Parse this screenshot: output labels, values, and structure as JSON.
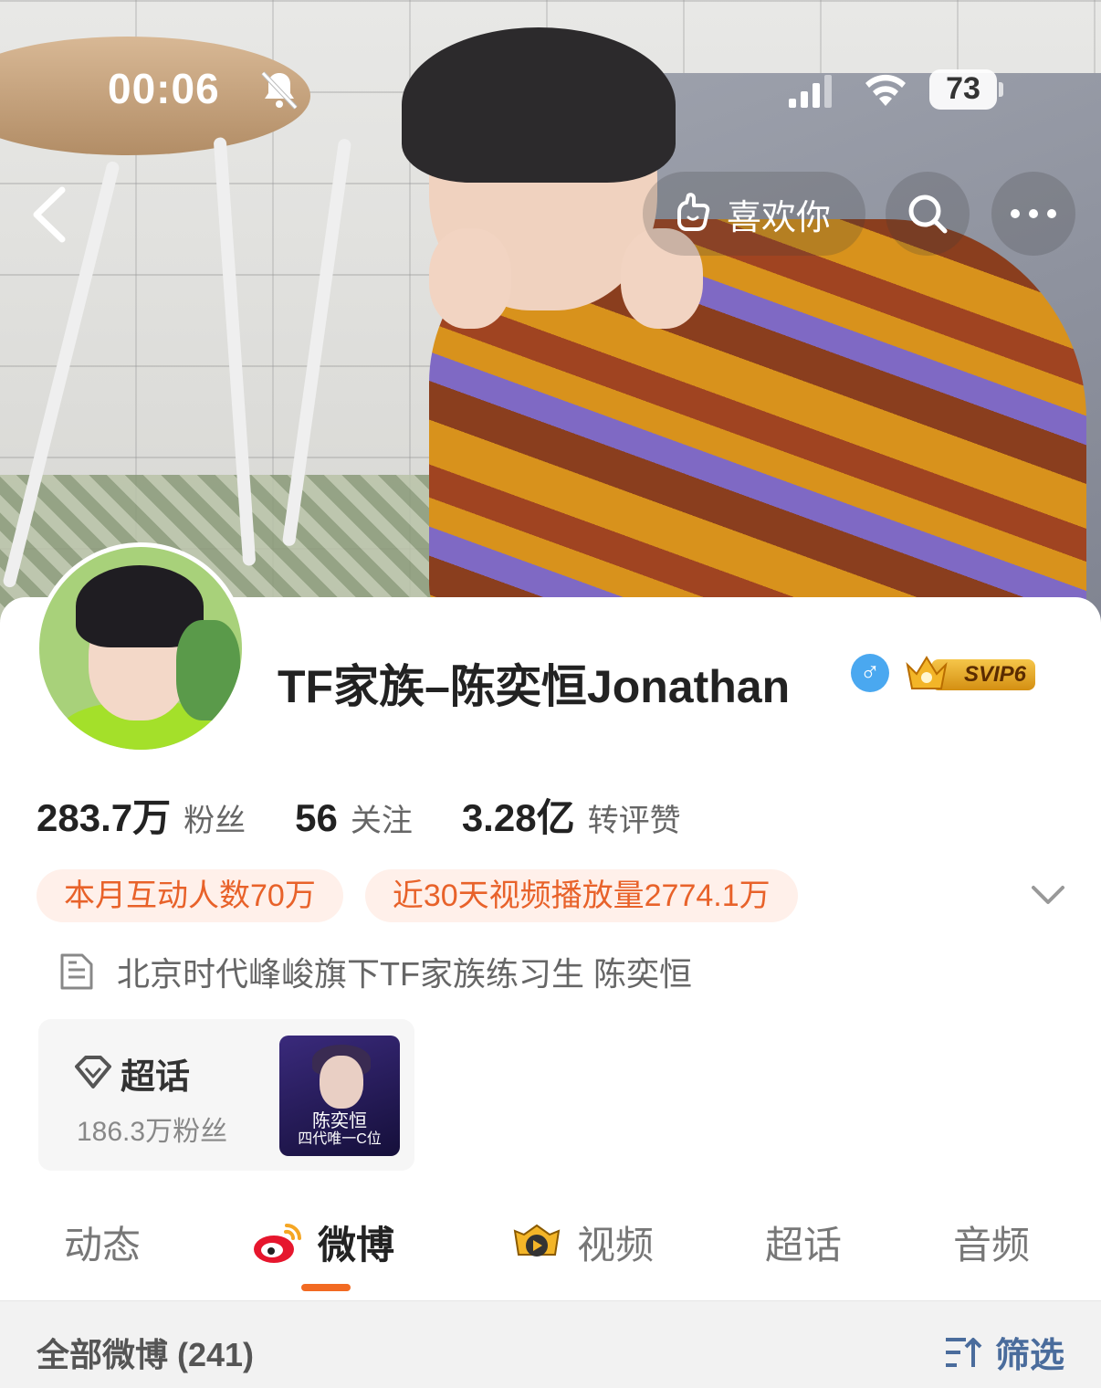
{
  "status_bar": {
    "time": "00:06",
    "battery": "73"
  },
  "nav": {
    "like_label": "喜欢你"
  },
  "profile": {
    "name": "TF家族–陈奕恒Jonathan",
    "vip_badge": "SVIP6",
    "gender_symbol": "♂",
    "stats": [
      {
        "value": "283.7万",
        "label": "粉丝"
      },
      {
        "value": "56",
        "label": "关注"
      },
      {
        "value": "3.28亿",
        "label": "转评赞"
      }
    ],
    "chips": [
      "本月互动人数70万",
      "近30天视频播放量2774.1万"
    ],
    "bio": "北京时代峰峻旗下TF家族练习生 陈奕恒",
    "supertopic": {
      "title": "超话",
      "fans": "186.3万粉丝",
      "thumb_title": "陈奕恒",
      "thumb_subtitle": "四代唯一C位"
    }
  },
  "tabs": [
    {
      "label": "动态",
      "active": false
    },
    {
      "label": "微博",
      "active": true
    },
    {
      "label": "视频",
      "active": false
    },
    {
      "label": "超话",
      "active": false
    },
    {
      "label": "音频",
      "active": false
    }
  ],
  "feed": {
    "all_label": "全部微博 (241)",
    "filter_label": "筛选"
  },
  "colors": {
    "accent": "#f26a22",
    "chip_text": "#e8622a",
    "chip_bg": "#fff0ea",
    "filter": "#4a6c9c"
  },
  "icons": [
    "bell-off-icon",
    "signal-icon",
    "wifi-icon",
    "battery-icon",
    "back-icon",
    "like-hand-icon",
    "search-icon",
    "more-icon",
    "male-icon",
    "crown-icon",
    "chevron-down-icon",
    "document-icon",
    "supertopic-diamond-icon",
    "weibo-logo-icon",
    "video-play-icon",
    "filter-icon"
  ]
}
